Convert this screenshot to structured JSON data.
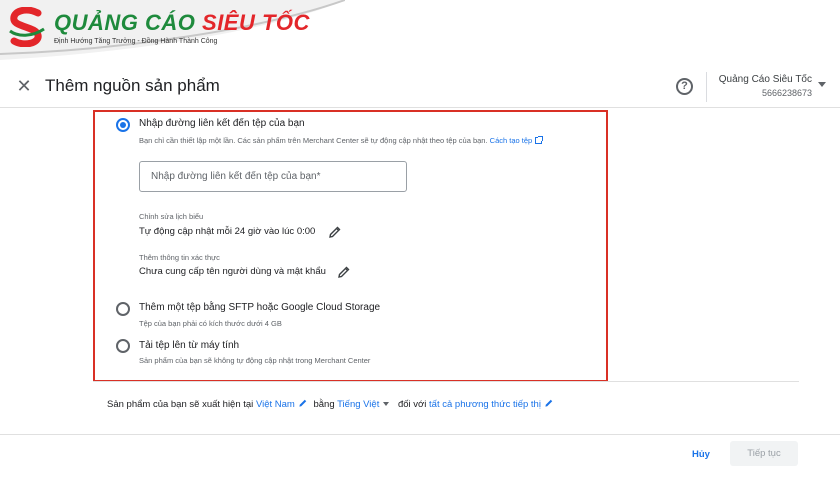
{
  "logo": {
    "title_green": "QUẢNG CÁO",
    "title_red": "SIÊU TỐC",
    "tagline": "Định Hướng Tăng Trưởng - Đồng Hành Thành Công"
  },
  "header": {
    "title": "Thêm nguồn sản phẩm",
    "account_name": "Quảng Cáo Siêu Tốc",
    "account_id": "5666238673"
  },
  "options": [
    {
      "label": "Nhập đường liên kết đến tệp của bạn",
      "desc": "Bạn chỉ cần thiết lập một lần. Các sản phẩm trên Merchant Center sẽ tự động cập nhật theo tệp của bạn.",
      "link": "Cách tạo tệp",
      "selected": true
    },
    {
      "label": "Thêm một tệp bằng SFTP hoặc Google Cloud Storage",
      "desc": "Tệp của bạn phải có kích thước dưới 4 GB",
      "selected": false
    },
    {
      "label": "Tải tệp lên từ máy tính",
      "desc": "Sản phẩm của bạn sẽ không tự động cập nhật trong Merchant Center",
      "selected": false
    }
  ],
  "url_input": {
    "placeholder": "Nhập đường liên kết đến tệp của bạn*",
    "value": ""
  },
  "schedule": {
    "caption": "Chỉnh sửa lịch biểu",
    "value": "Tự động cập nhật mỗi 24 giờ vào lúc 0:00"
  },
  "credentials": {
    "caption": "Thêm thông tin xác thực",
    "value": "Chưa cung cấp tên người dùng và mật khẩu"
  },
  "appear": {
    "prefix": "Sản phẩm của bạn sẽ xuất hiện tại",
    "country": "Việt Nam",
    "language_prefix": "bằng",
    "language": "Tiếng Việt",
    "method_prefix": "đối với",
    "method": "tất cả phương thức tiếp thị"
  },
  "footer": {
    "cancel_label": "Hủy",
    "continue_label": "Tiếp tục"
  },
  "colors": {
    "accent": "#1a73e8",
    "highlight": "#d93025",
    "logo_green": "#1e8a3c",
    "logo_red": "#e3262a"
  }
}
